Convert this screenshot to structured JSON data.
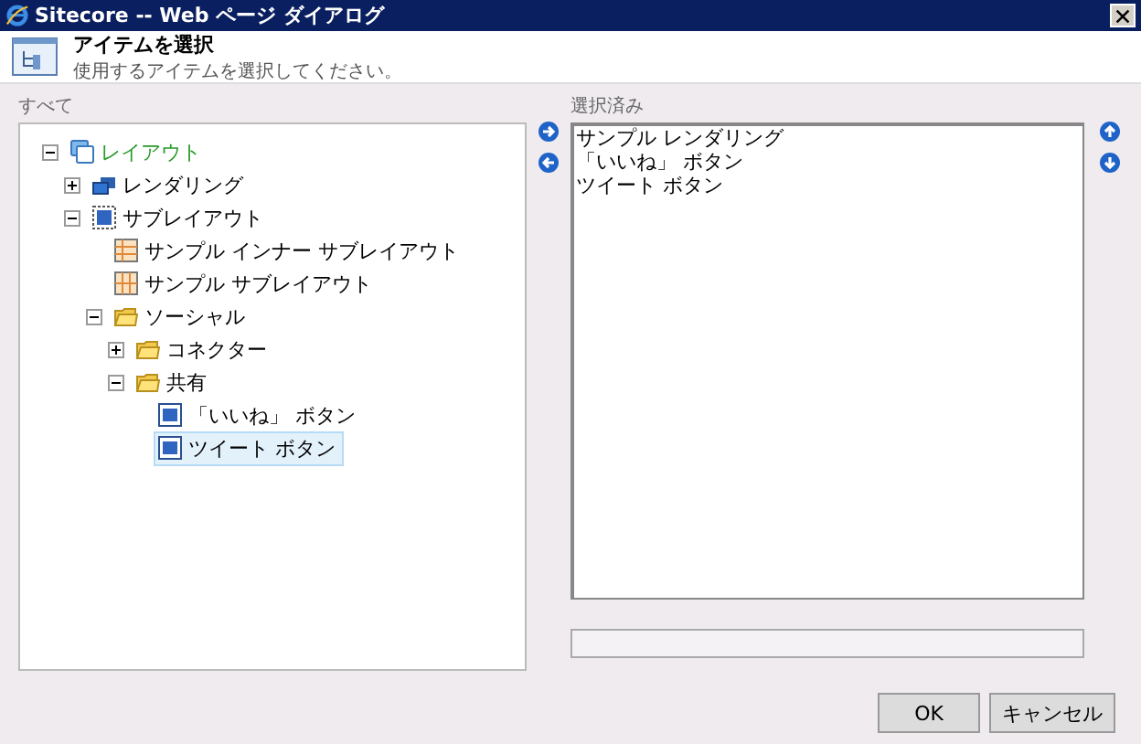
{
  "window": {
    "title": "Sitecore -- Web ページ ダイアログ"
  },
  "header": {
    "title": "アイテムを選択",
    "subtitle": "使用するアイテムを選択してください。"
  },
  "all_panel": {
    "label": "すべて",
    "tree": [
      {
        "label": "レイアウト",
        "kind": "layout",
        "expanded": true,
        "highlighted": true,
        "selected": false,
        "children": [
          {
            "label": "レンダリング",
            "kind": "rendering",
            "expanded": false,
            "highlighted": false,
            "selected": false
          },
          {
            "label": "サブレイアウト",
            "kind": "sublayout",
            "expanded": true,
            "highlighted": false,
            "selected": false,
            "children": [
              {
                "label": "サンプル インナー サブレイアウト",
                "kind": "grid-rows",
                "highlighted": false,
                "selected": false
              },
              {
                "label": "サンプル サブレイアウト",
                "kind": "grid-cols",
                "highlighted": false,
                "selected": false
              },
              {
                "label": "ソーシャル",
                "kind": "folder",
                "expanded": true,
                "highlighted": false,
                "selected": false,
                "children": [
                  {
                    "label": "コネクター",
                    "kind": "folder",
                    "expanded": false,
                    "highlighted": false,
                    "selected": false
                  },
                  {
                    "label": "共有",
                    "kind": "folder",
                    "expanded": true,
                    "highlighted": false,
                    "selected": false,
                    "children": [
                      {
                        "label": "「いいね」 ボタン",
                        "kind": "button",
                        "highlighted": false,
                        "selected": false
                      },
                      {
                        "label": "ツイート ボタン",
                        "kind": "button",
                        "highlighted": false,
                        "selected": true
                      }
                    ]
                  }
                ]
              }
            ]
          }
        ]
      }
    ]
  },
  "selected_panel": {
    "label": "選択済み",
    "items": [
      "サンプル レンダリング",
      "「いいね」 ボタン",
      "ツイート ボタン"
    ]
  },
  "buttons": [
    {
      "label": "OK"
    },
    {
      "label": "キャンセル"
    }
  ]
}
